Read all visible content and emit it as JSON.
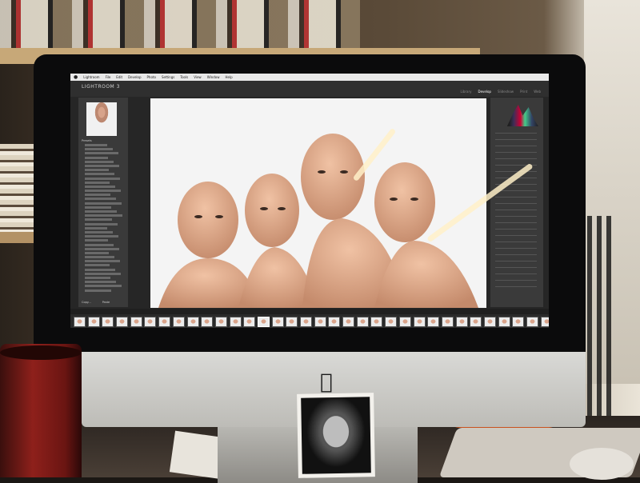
{
  "menubar": {
    "items": [
      "Lightroom",
      "File",
      "Edit",
      "Develop",
      "Photo",
      "Settings",
      "Tools",
      "View",
      "Window",
      "Help"
    ]
  },
  "app": {
    "title": "LIGHTROOM 3",
    "catalog_name": "",
    "modules": [
      "Library",
      "Develop",
      "Slideshow",
      "Print",
      "Web"
    ],
    "active_module": "Develop"
  },
  "left_panel": {
    "section": "Presets",
    "buttons": [
      "Copy...",
      "Paste"
    ]
  },
  "filmstrip": {
    "thumbnail_count": 38,
    "selected_index": 13
  },
  "room": {
    "device_logo": "apple-logo",
    "accent_cup": "#8e201b",
    "accent_orange": "#d9571f"
  }
}
